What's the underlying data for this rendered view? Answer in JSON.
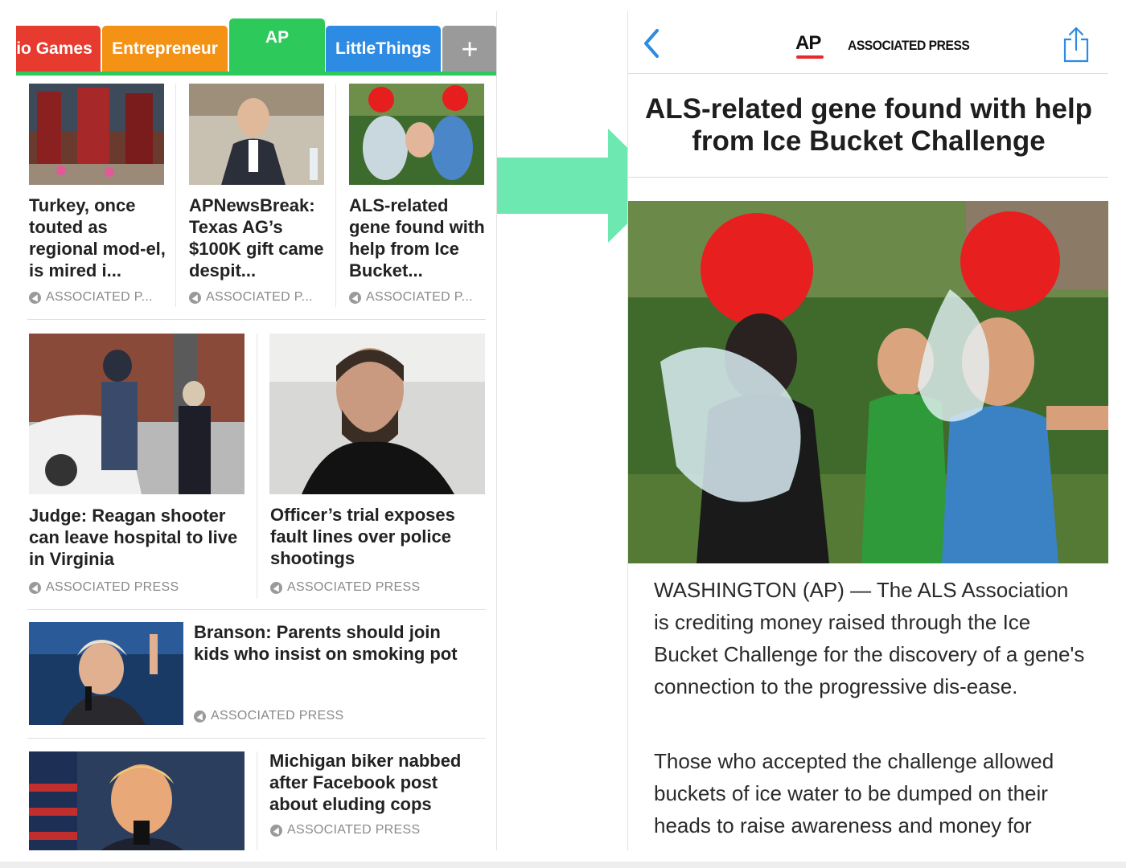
{
  "tabs": [
    {
      "label": "io Games",
      "color": "#e63b2e"
    },
    {
      "label": "Entrepreneur",
      "color": "#f39214"
    },
    {
      "label": "AP",
      "color": "#2ec95b",
      "active": true
    },
    {
      "label": "LittleThings",
      "color": "#2d8be3"
    },
    {
      "label": "+",
      "color": "#9a9a9a"
    }
  ],
  "feed": {
    "row1": [
      {
        "headline": "Turkey, once touted as regional mod-el, is mired i...",
        "source": "ASSOCIATED P..."
      },
      {
        "headline": "APNewsBreak: Texas AG’s $100K gift came despit...",
        "source": "ASSOCIATED P..."
      },
      {
        "headline": "ALS-related gene found with help from Ice Bucket...",
        "source": "ASSOCIATED P..."
      }
    ],
    "row2": [
      {
        "headline": "Judge: Reagan shooter can leave hospital to live in Virginia",
        "source": "ASSOCIATED PRESS"
      },
      {
        "headline": "Officer’s trial exposes fault lines over police shootings",
        "source": "ASSOCIATED PRESS"
      }
    ],
    "row3": {
      "headline": "Branson: Parents should join kids who insist on smoking pot",
      "source": "ASSOCIATED PRESS"
    },
    "row4": {
      "headline": "Michigan biker nabbed after Facebook post about eluding cops",
      "source": "ASSOCIATED PRESS"
    }
  },
  "article": {
    "publisher_logo": "AP",
    "publisher_name": "ASSOCIATED PRESS",
    "title": "ALS-related gene found with help from Ice Bucket Challenge",
    "paragraphs": [
      "WASHINGTON (AP) — The ALS Association is crediting money raised through the Ice Bucket Challenge for the discovery of a gene's connection to the progressive dis-ease.",
      "Those who accepted the challenge allowed buckets of ice water to be dumped on their heads to raise awareness and money for"
    ]
  },
  "colors": {
    "accent_green": "#2ec95b",
    "arrow": "#6de8b1",
    "ios_blue": "#2d8be3",
    "ap_red": "#e52b2b"
  },
  "icons": {
    "back": "chevron-left-icon",
    "share": "share-icon",
    "source": "flipboard-source-icon",
    "transition": "right-arrow-icon"
  }
}
